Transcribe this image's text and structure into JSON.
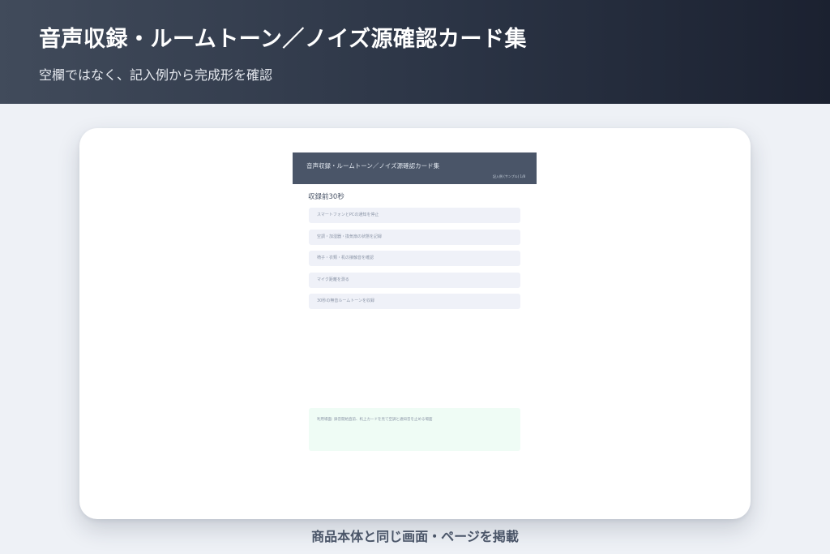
{
  "hero": {
    "title": "音声収録・ルームトーン／ノイズ源確認カード集",
    "subtitle": "空欄ではなく、記入例から完成形を確認"
  },
  "card": {
    "title": "音声収録・ルームトーン／ノイズ源確認カード集",
    "header_note": "記入例 (サンプル) 1/8",
    "section_heading": "収録前30秒",
    "items": [
      "スマートフォンとPCの通知を停止",
      "空調・加湿器・換気扇の状態を記録",
      "椅子・衣類・机の接触音を確認",
      "マイク距離を測る",
      "30秒の無音ルームトーンを収録"
    ],
    "memo": "利用場面: 録音開始直前、机上カードを見て空調と通知音を止める場面"
  },
  "caption": "商品本体と同じ画面・ページを掲載",
  "colors": {
    "hero_start": "#414b5b",
    "hero_end": "#1b2130",
    "card_header": "#4a5568",
    "item_bg": "#eff1f8",
    "memo_bg": "#effcf5",
    "page_bg": "#eef1f6"
  }
}
